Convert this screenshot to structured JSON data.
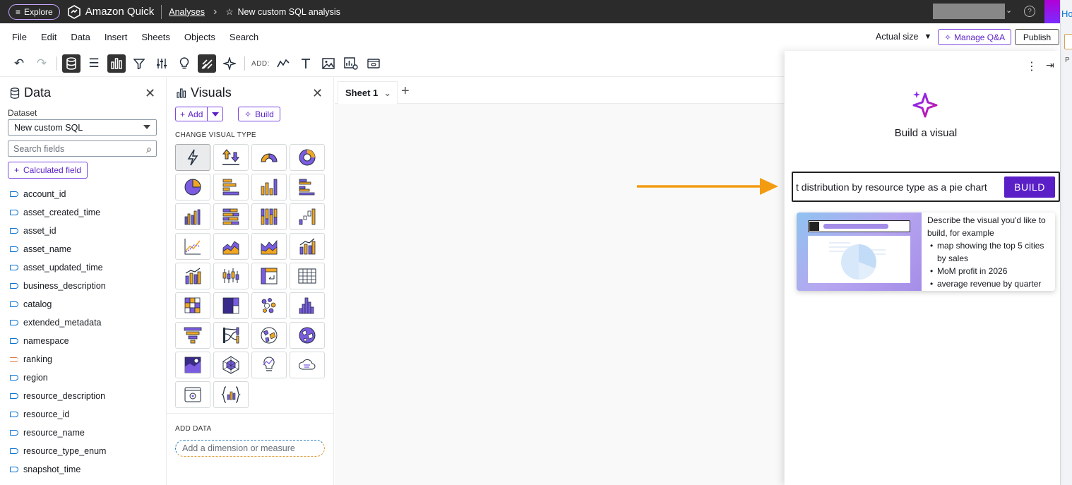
{
  "topbar": {
    "explore_label": "Explore",
    "app_name": "Amazon Quick",
    "breadcrumb": "Analyses",
    "analysis_title": "New custom SQL analysis"
  },
  "menu": [
    "File",
    "Edit",
    "Data",
    "Insert",
    "Sheets",
    "Objects",
    "Search"
  ],
  "menubar_right": {
    "actual_size": "Actual size",
    "manage_qa": "Manage Q&A",
    "publish": "Publish"
  },
  "toolbar": {
    "add_label": "ADD:"
  },
  "data_panel": {
    "title": "Data",
    "dataset_label": "Dataset",
    "dataset_value": "New custom SQL",
    "search_placeholder": "Search fields",
    "calc_field": "Calculated field",
    "fields": [
      {
        "name": "account_id",
        "kind": "dimension"
      },
      {
        "name": "asset_created_time",
        "kind": "dimension"
      },
      {
        "name": "asset_id",
        "kind": "dimension"
      },
      {
        "name": "asset_name",
        "kind": "dimension"
      },
      {
        "name": "asset_updated_time",
        "kind": "dimension"
      },
      {
        "name": "business_description",
        "kind": "dimension"
      },
      {
        "name": "catalog",
        "kind": "dimension"
      },
      {
        "name": "extended_metadata",
        "kind": "dimension"
      },
      {
        "name": "namespace",
        "kind": "dimension"
      },
      {
        "name": "ranking",
        "kind": "measure"
      },
      {
        "name": "region",
        "kind": "dimension"
      },
      {
        "name": "resource_description",
        "kind": "dimension"
      },
      {
        "name": "resource_id",
        "kind": "dimension"
      },
      {
        "name": "resource_name",
        "kind": "dimension"
      },
      {
        "name": "resource_type_enum",
        "kind": "dimension"
      },
      {
        "name": "snapshot_time",
        "kind": "dimension"
      }
    ]
  },
  "visuals_panel": {
    "title": "Visuals",
    "add_label": "Add",
    "build_label": "Build",
    "change_type_label": "CHANGE VISUAL TYPE",
    "add_data_label": "ADD DATA",
    "add_dim_placeholder": "Add a dimension or measure"
  },
  "canvas": {
    "sheet_tab": "Sheet 1"
  },
  "build_panel": {
    "title": "Build a visual",
    "input_text": "t distribution by resource type as a pie chart",
    "build_button": "BUILD",
    "tip_intro": "Describe the visual you'd like to build, for example",
    "tip_examples": [
      "map showing the top 5 cities by sales",
      "MoM profit in 2026",
      "average revenue by quarter"
    ]
  },
  "colors": {
    "accent": "#5b1fc7",
    "arrow": "#f39c12",
    "gold": "#f0a623"
  }
}
